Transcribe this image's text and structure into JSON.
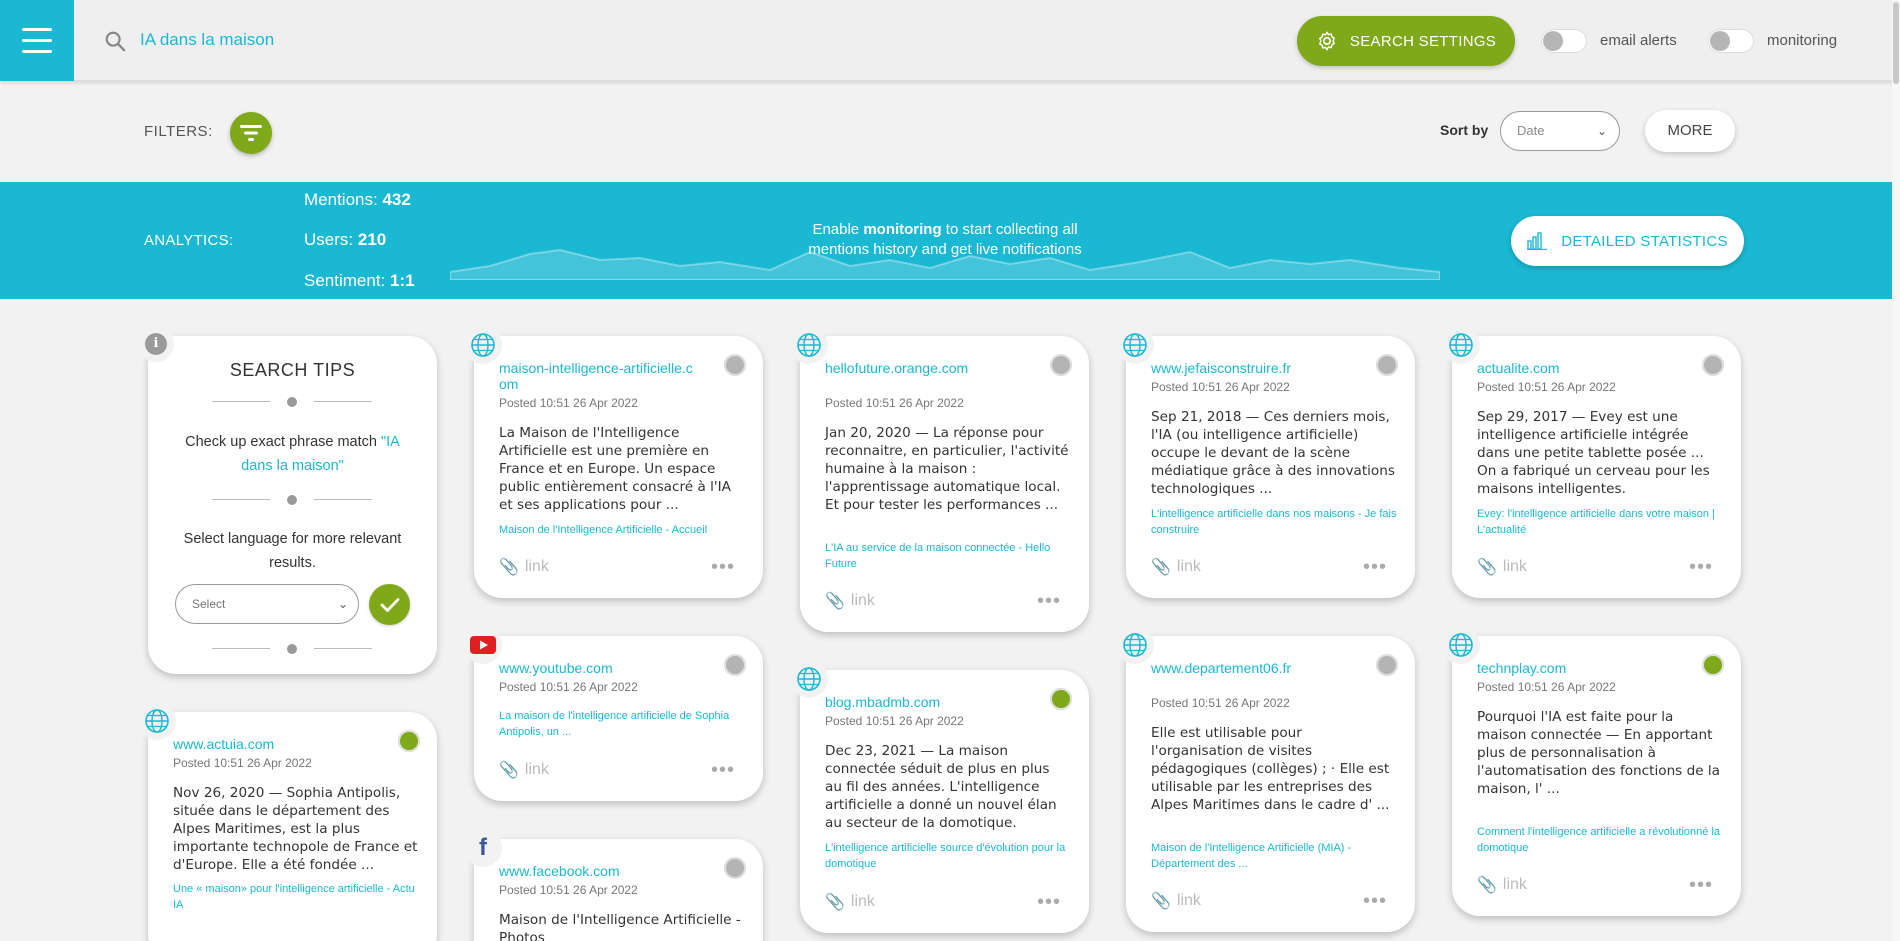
{
  "header": {
    "search_query": "IA dans la maison",
    "search_settings_label": "SEARCH SETTINGS",
    "email_alerts_label": "email alerts",
    "monitoring_label": "monitoring"
  },
  "filters": {
    "label": "FILTERS:",
    "sort_by_label": "Sort by",
    "sort_value": "Date",
    "more_label": "MORE"
  },
  "analytics": {
    "label": "ANALYTICS:",
    "mentions_label": "Mentions:",
    "mentions_value": "432",
    "users_label": "Users:",
    "users_value": "210",
    "sentiment_label": "Sentiment:",
    "sentiment_value": "1:1",
    "monitor_msg_pre": "Enable ",
    "monitor_msg_bold": "monitoring",
    "monitor_msg_post": " to start collecting all mentions history and get live notifications",
    "detailed_label": "DETAILED STATISTICS",
    "accent": "#1ab8d2"
  },
  "tips": {
    "title": "SEARCH TIPS",
    "phrase_pre": "Check up exact phrase match ",
    "phrase_query": "\"IA dans la maison\"",
    "language_text": "Select language for more relevant results.",
    "select_placeholder": "Select"
  },
  "cards": [
    {
      "icon": "globe-icon",
      "domain": "www.actuia.com",
      "status": "green",
      "posted": "Posted 10:51 26 Apr 2022",
      "body": "Nov 26, 2020 — Sophia Antipolis, située dans le département des Alpes Maritimes, est la plus importante technopole de France et d'Europe. Elle a été fondée ...",
      "title_link": "Une « maison» pour l'intelligence artificielle - Actu IA"
    },
    {
      "icon": "globe-icon",
      "domain": "maison-intelligence-artificielle.com",
      "status": "grey",
      "posted": "Posted 10:51 26 Apr 2022",
      "body": "La Maison de l'Intelligence Artificielle est une première en France et en Europe. Un espace public entièrement consacré à l'IA et ses applications pour ...",
      "title_link": "Maison de l'Intelligence Artificielle - Accueil",
      "link": "link"
    },
    {
      "icon": "youtube-icon",
      "domain": "www.youtube.com",
      "status": "grey",
      "posted": "Posted 10:51 26 Apr 2022",
      "body": "",
      "title_link": "La maison de l'intelligence artificielle de Sophia Antipolis, un ...",
      "link": "link"
    },
    {
      "icon": "facebook-icon",
      "domain": "www.facebook.com",
      "status": "grey",
      "posted": "Posted 10:51 26 Apr 2022",
      "body": "Maison de l'Intelligence Artificielle - Photos",
      "title_link": ""
    },
    {
      "icon": "globe-icon",
      "domain": "hellofuture.orange.com",
      "status": "grey",
      "posted": "Posted 10:51 26 Apr 2022",
      "body": "Jan 20, 2020 — La réponse pour reconnaitre, en particulier, l'activité humaine à la maison : l'apprentissage automatique local. Et pour tester les performances ...",
      "title_link": "L'IA au service de la maison connectée - Hello Future",
      "link": "link"
    },
    {
      "icon": "globe-icon",
      "domain": "blog.mbadmb.com",
      "status": "green",
      "posted": "Posted 10:51 26 Apr 2022",
      "body": "Dec 23, 2021 — La maison connectée séduit de plus en plus au fil des années. L'intelligence artificielle a donné un nouvel élan au secteur de la domotique.",
      "title_link": "L'intelligence artificielle source d'évolution pour la domotique",
      "link": "link"
    },
    {
      "icon": "globe-icon",
      "domain": "www.jefaisconstruire.fr",
      "status": "grey",
      "posted": "Posted 10:51 26 Apr 2022",
      "body": "Sep 21, 2018 — Ces derniers mois, l'IA (ou intelligence artificielle) occupe le devant de la scène médiatique grâce à des innovations technologiques ...",
      "title_link": "L'intelligence artificielle dans nos maisons - Je fais construire",
      "link": "link"
    },
    {
      "icon": "globe-icon",
      "domain": "www.departement06.fr",
      "status": "grey",
      "posted": "Posted 10:51 26 Apr 2022",
      "body": "Elle est utilisable pour l'organisation de visites pédagogiques (collèges) ; · Elle est utilisable par les entreprises des Alpes Maritimes dans le cadre d' ...",
      "title_link": "Maison de l'Intelligence Artificielle (MIA) - Département des ...",
      "link": "link"
    },
    {
      "icon": "globe-icon",
      "domain": "actualite.com",
      "status": "grey",
      "posted": "Posted 10:51 26 Apr 2022",
      "body": "Sep 29, 2017 — Evey est une intelligence artificielle intégrée dans une petite tablette posée ... On a fabriqué un cerveau pour les maisons intelligentes.",
      "title_link": "Evey: l'intelligence artificielle dans votre maison | L'actualité",
      "link": "link"
    },
    {
      "icon": "globe-icon",
      "domain": "technplay.com",
      "status": "green",
      "posted": "Posted 10:51 26 Apr 2022",
      "body": "Pourquoi l'IA est faite pour la maison connectée — En apportant plus de personnalisation à l'automatisation des fonctions de la maison, l' ...",
      "title_link": "Comment l'intelligence artificielle a révolutionné la domotique",
      "link": "link"
    }
  ]
}
